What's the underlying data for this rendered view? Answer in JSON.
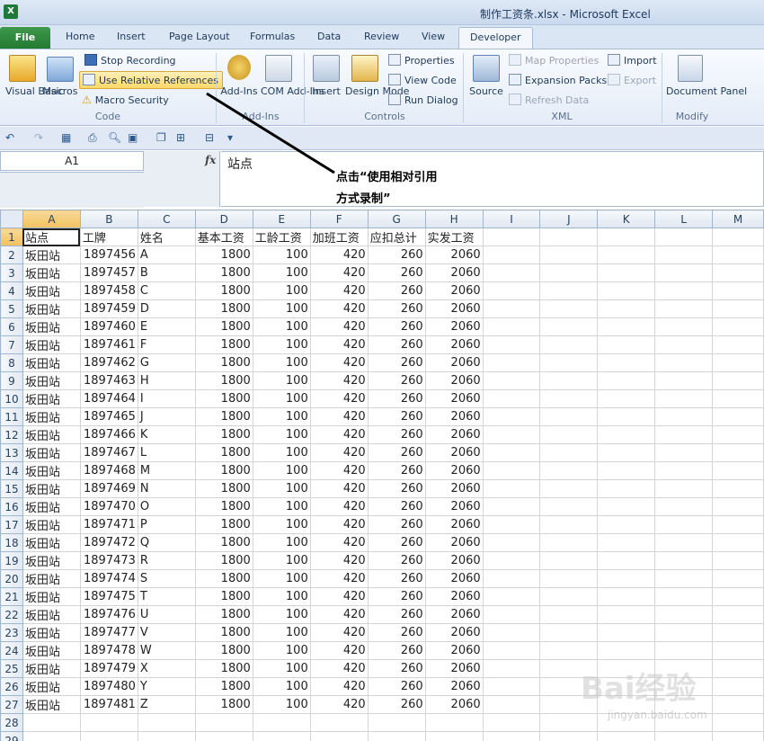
{
  "window": {
    "title": "制作工资条.xlsx - Microsoft Excel",
    "app_icon": "X"
  },
  "ribbon_tabs": [
    "File",
    "Home",
    "Insert",
    "Page Layout",
    "Formulas",
    "Data",
    "Review",
    "View",
    "Developer"
  ],
  "active_tab": "Developer",
  "ribbon": {
    "code": {
      "visual_basic": "Visual Basic",
      "macros": "Macros",
      "stop_recording": "Stop Recording",
      "use_relative": "Use Relative References",
      "macro_security": "Macro Security",
      "group": "Code"
    },
    "addins": {
      "addins": "Add-Ins",
      "com_addins": "COM Add-Ins",
      "group": "Add-Ins"
    },
    "controls": {
      "insert": "Insert",
      "design_mode": "Design Mode",
      "properties": "Properties",
      "view_code": "View Code",
      "run_dialog": "Run Dialog",
      "group": "Controls"
    },
    "xml": {
      "source": "Source",
      "map_properties": "Map Properties",
      "expansion_packs": "Expansion Packs",
      "refresh_data": "Refresh Data",
      "import": "Import",
      "export": "Export",
      "group": "XML"
    },
    "modify": {
      "document_panel": "Document Panel",
      "group": "Modify"
    }
  },
  "formula_bar": {
    "name_box": "A1",
    "fx": "fx",
    "content": "站点"
  },
  "annotation": {
    "line1": "点击“使用相对引用",
    "line2": "方式录制”"
  },
  "columns": [
    "A",
    "B",
    "C",
    "D",
    "E",
    "F",
    "G",
    "H",
    "I",
    "J",
    "K",
    "L",
    "M"
  ],
  "header_row": [
    "站点",
    "工牌",
    "姓名",
    "基本工资",
    "工龄工资",
    "加班工资",
    "应扣总计",
    "实发工资"
  ],
  "rows": [
    [
      "坂田站",
      "1897456",
      "A",
      "1800",
      "100",
      "420",
      "260",
      "2060"
    ],
    [
      "坂田站",
      "1897457",
      "B",
      "1800",
      "100",
      "420",
      "260",
      "2060"
    ],
    [
      "坂田站",
      "1897458",
      "C",
      "1800",
      "100",
      "420",
      "260",
      "2060"
    ],
    [
      "坂田站",
      "1897459",
      "D",
      "1800",
      "100",
      "420",
      "260",
      "2060"
    ],
    [
      "坂田站",
      "1897460",
      "E",
      "1800",
      "100",
      "420",
      "260",
      "2060"
    ],
    [
      "坂田站",
      "1897461",
      "F",
      "1800",
      "100",
      "420",
      "260",
      "2060"
    ],
    [
      "坂田站",
      "1897462",
      "G",
      "1800",
      "100",
      "420",
      "260",
      "2060"
    ],
    [
      "坂田站",
      "1897463",
      "H",
      "1800",
      "100",
      "420",
      "260",
      "2060"
    ],
    [
      "坂田站",
      "1897464",
      "I",
      "1800",
      "100",
      "420",
      "260",
      "2060"
    ],
    [
      "坂田站",
      "1897465",
      "J",
      "1800",
      "100",
      "420",
      "260",
      "2060"
    ],
    [
      "坂田站",
      "1897466",
      "K",
      "1800",
      "100",
      "420",
      "260",
      "2060"
    ],
    [
      "坂田站",
      "1897467",
      "L",
      "1800",
      "100",
      "420",
      "260",
      "2060"
    ],
    [
      "坂田站",
      "1897468",
      "M",
      "1800",
      "100",
      "420",
      "260",
      "2060"
    ],
    [
      "坂田站",
      "1897469",
      "N",
      "1800",
      "100",
      "420",
      "260",
      "2060"
    ],
    [
      "坂田站",
      "1897470",
      "O",
      "1800",
      "100",
      "420",
      "260",
      "2060"
    ],
    [
      "坂田站",
      "1897471",
      "P",
      "1800",
      "100",
      "420",
      "260",
      "2060"
    ],
    [
      "坂田站",
      "1897472",
      "Q",
      "1800",
      "100",
      "420",
      "260",
      "2060"
    ],
    [
      "坂田站",
      "1897473",
      "R",
      "1800",
      "100",
      "420",
      "260",
      "2060"
    ],
    [
      "坂田站",
      "1897474",
      "S",
      "1800",
      "100",
      "420",
      "260",
      "2060"
    ],
    [
      "坂田站",
      "1897475",
      "T",
      "1800",
      "100",
      "420",
      "260",
      "2060"
    ],
    [
      "坂田站",
      "1897476",
      "U",
      "1800",
      "100",
      "420",
      "260",
      "2060"
    ],
    [
      "坂田站",
      "1897477",
      "V",
      "1800",
      "100",
      "420",
      "260",
      "2060"
    ],
    [
      "坂田站",
      "1897478",
      "W",
      "1800",
      "100",
      "420",
      "260",
      "2060"
    ],
    [
      "坂田站",
      "1897479",
      "X",
      "1800",
      "100",
      "420",
      "260",
      "2060"
    ],
    [
      "坂田站",
      "1897480",
      "Y",
      "1800",
      "100",
      "420",
      "260",
      "2060"
    ],
    [
      "坂田站",
      "1897481",
      "Z",
      "1800",
      "100",
      "420",
      "260",
      "2060"
    ]
  ],
  "extra_rows": [
    "28",
    "29"
  ],
  "watermark": {
    "brand": "Bai经验",
    "url": "jingyan.baidu.com"
  },
  "colors": {
    "file_tab": "#217a31",
    "highlight": "#ffd86a",
    "selected_header": "#f1c15f",
    "annotation_line": "#000000"
  }
}
